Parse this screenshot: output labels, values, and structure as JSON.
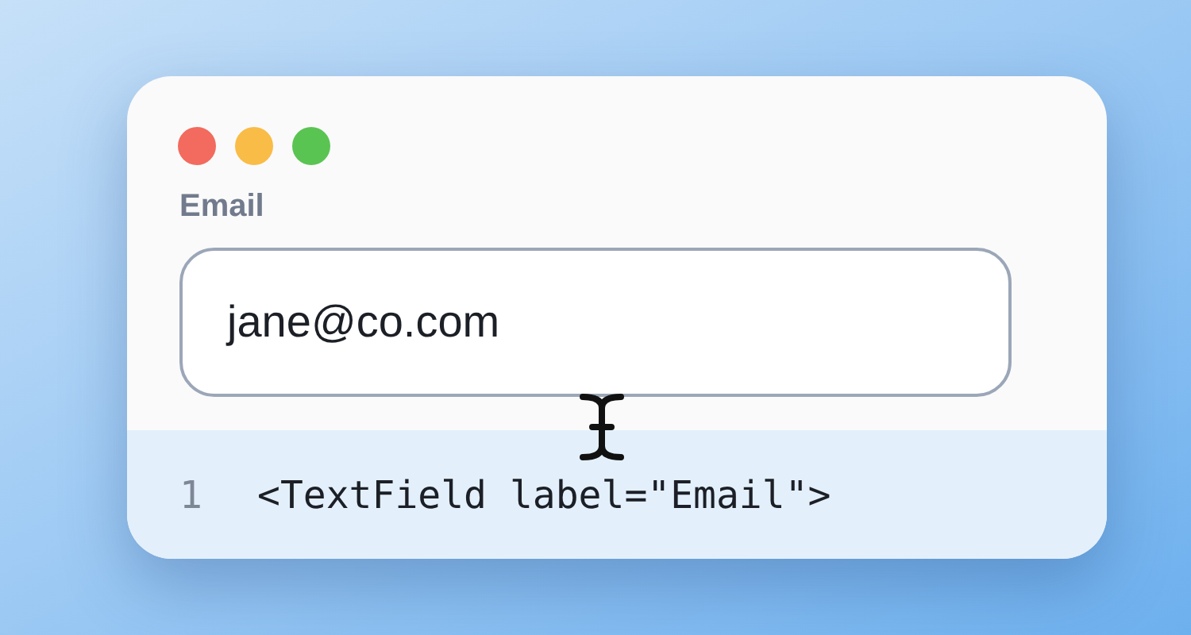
{
  "window": {
    "controls": [
      {
        "color": "#f26b5e"
      },
      {
        "color": "#f9bc47"
      },
      {
        "color": "#5ac453"
      }
    ]
  },
  "field": {
    "label": "Email",
    "value": "jane@co.com"
  },
  "code": [
    {
      "number": "1",
      "text": "<TextField label=\"Email\">"
    }
  ]
}
